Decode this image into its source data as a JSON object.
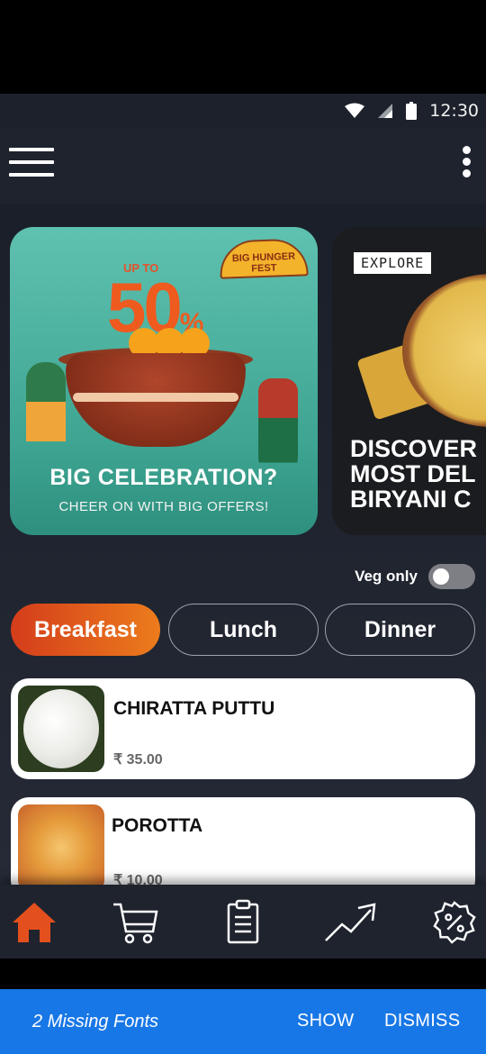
{
  "status_bar": {
    "time": "12:30",
    "icons": [
      "wifi-icon",
      "signal-icon",
      "battery-icon"
    ]
  },
  "app_bar": {
    "menu_icon": "hamburger-icon",
    "more_icon": "more-vertical-icon"
  },
  "banners": [
    {
      "badge": "BIG HUNGER FEST",
      "upto": "UP TO",
      "percent": "50",
      "percent_sign": "%",
      "title": "BIG CELEBRATION?",
      "subtitle": "CHEER ON WITH BIG OFFERS!"
    },
    {
      "tag": "EXPLORE",
      "line1": "DISCOVER",
      "line2": "MOST DEL",
      "line3": "BIRYANI C"
    }
  ],
  "filters": {
    "veg_only_label": "Veg only",
    "veg_only_enabled": false
  },
  "tabs": [
    {
      "label": "Breakfast",
      "active": true
    },
    {
      "label": "Lunch",
      "active": false
    },
    {
      "label": "Dinner",
      "active": false
    }
  ],
  "items": [
    {
      "name": "CHIRATTA PUTTU",
      "currency": "₹",
      "price": "35.00"
    },
    {
      "name": "POROTTA",
      "currency": "₹",
      "price": "10.00"
    }
  ],
  "bottom_nav": [
    {
      "icon": "home-icon",
      "active": true
    },
    {
      "icon": "cart-icon",
      "active": false
    },
    {
      "icon": "clipboard-icon",
      "active": false
    },
    {
      "icon": "trending-up-icon",
      "active": false
    },
    {
      "icon": "discount-badge-icon",
      "active": false
    }
  ],
  "snackbar": {
    "message": "2 Missing Fonts",
    "show_label": "SHOW",
    "dismiss_label": "DISMISS"
  },
  "colors": {
    "accent": "#e4501d",
    "background": "#1e232e",
    "snackbar": "#1877e6"
  }
}
